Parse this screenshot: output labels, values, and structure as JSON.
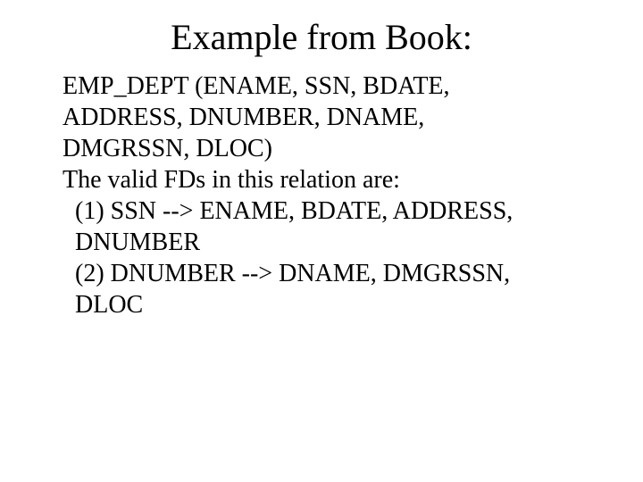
{
  "title": "Example from Book:",
  "body": {
    "schema_l1": "EMP_DEPT (ENAME, SSN, BDATE,",
    "schema_l2": "ADDRESS,    DNUMBER,    DNAME,",
    "schema_l3": "DMGRSSN, DLOC)",
    "fd_intro": "The valid  FDs in this relation are:",
    "fd1_l1": " (1) SSN --> ENAME, BDATE, ADDRESS,",
    "fd1_l2": "DNUMBER",
    "fd2_l1": " (2)  DNUMBER --> DNAME, DMGRSSN,",
    "fd2_l2": "DLOC"
  }
}
